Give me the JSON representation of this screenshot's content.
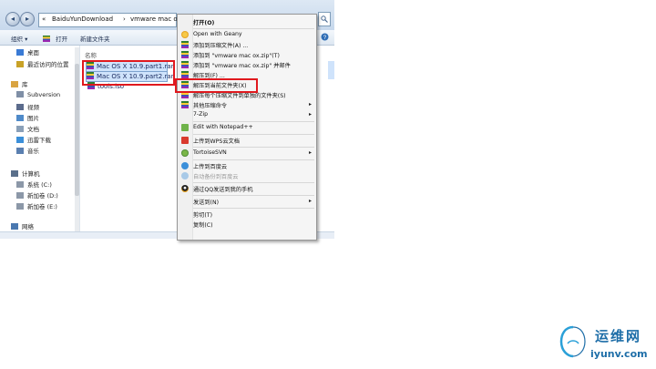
{
  "explorer": {
    "breadcrumb_prefix": "«",
    "breadcrumb_1": "BaiduYunDownload",
    "breadcrumb_sep": "›",
    "breadcrumb_2": "vmware mac ox",
    "toolbar": {
      "organize": "组织",
      "open": "打开",
      "new_folder": "新建文件夹"
    },
    "nav_items": [
      {
        "label": "桌面",
        "icon": "desktop-icon"
      },
      {
        "label": "最近访问的位置",
        "icon": "recent-icon"
      },
      {
        "label": "库",
        "icon": "library-icon"
      },
      {
        "label": "Subversion",
        "icon": "library-folder-icon"
      },
      {
        "label": "视频",
        "icon": "video-icon"
      },
      {
        "label": "图片",
        "icon": "picture-icon"
      },
      {
        "label": "文档",
        "icon": "document-icon"
      },
      {
        "label": "迅雷下载",
        "icon": "download-icon"
      },
      {
        "label": "音乐",
        "icon": "music-icon"
      },
      {
        "label": "计算机",
        "icon": "computer-icon"
      },
      {
        "label": "系统 (C:)",
        "icon": "drive-icon"
      },
      {
        "label": "新加卷 (D:)",
        "icon": "drive-icon"
      },
      {
        "label": "新加卷 (E:)",
        "icon": "drive-icon"
      },
      {
        "label": "网络",
        "icon": "network-icon"
      }
    ],
    "column_name": "名称",
    "files": [
      {
        "name": "Mac OS X 10.9.part1.rar",
        "selected": true
      },
      {
        "name": "Mac OS X 10.9.part2.rar",
        "selected": true
      },
      {
        "name": "tools.iso",
        "selected": false
      }
    ]
  },
  "context_menu": {
    "items": [
      {
        "label": "打开(O)",
        "bold": true,
        "icon": "none"
      },
      {
        "label": "Open with Geany",
        "icon": "geany-icon"
      },
      {
        "label": "添加到压缩文件(A) ...",
        "icon": "winrar-icon"
      },
      {
        "label": "添加到 \"vmware mac ox.zip\"(T)",
        "icon": "winrar-icon"
      },
      {
        "label": "添加到 \"vmware mac ox.zip\" 并邮件",
        "icon": "winrar-icon"
      },
      {
        "label": "解压到(F) ...",
        "icon": "winrar-icon"
      },
      {
        "label": "解压到当前文件夹(X)",
        "icon": "winrar-icon",
        "highlighted": true
      },
      {
        "label": "解压每个压缩文件到单独的文件夹(S)",
        "icon": "winrar-icon"
      },
      {
        "label": "其他压缩命令",
        "icon": "winrar-icon",
        "submenu": true
      },
      {
        "label": "7-Zip",
        "icon": "none",
        "submenu": true
      },
      {
        "label": "Edit with Notepad++",
        "icon": "notepad-icon"
      },
      {
        "label": "上传到WPS云文档",
        "icon": "wps-icon"
      },
      {
        "label": "TortoiseSVN",
        "icon": "tortoise-icon",
        "submenu": true
      },
      {
        "label": "上传到百度云",
        "icon": "baidu-icon"
      },
      {
        "label": "自动备份到百度云",
        "icon": "baidu-icon",
        "disabled": true
      },
      {
        "label": "通过QQ发送到我的手机",
        "icon": "qq-icon"
      },
      {
        "label": "发送到(N)",
        "icon": "none",
        "submenu": true
      },
      {
        "label": "剪切(T)",
        "icon": "none"
      },
      {
        "label": "复制(C)",
        "icon": "none"
      }
    ],
    "submenu_arrow": "▸"
  },
  "watermark": {
    "cn": "运维网",
    "en": "iyunv.com"
  },
  "colors": {
    "highlight_red": "#e0191e",
    "selection": "#cfe3fb",
    "brand_blue": "#1e6ea8"
  }
}
